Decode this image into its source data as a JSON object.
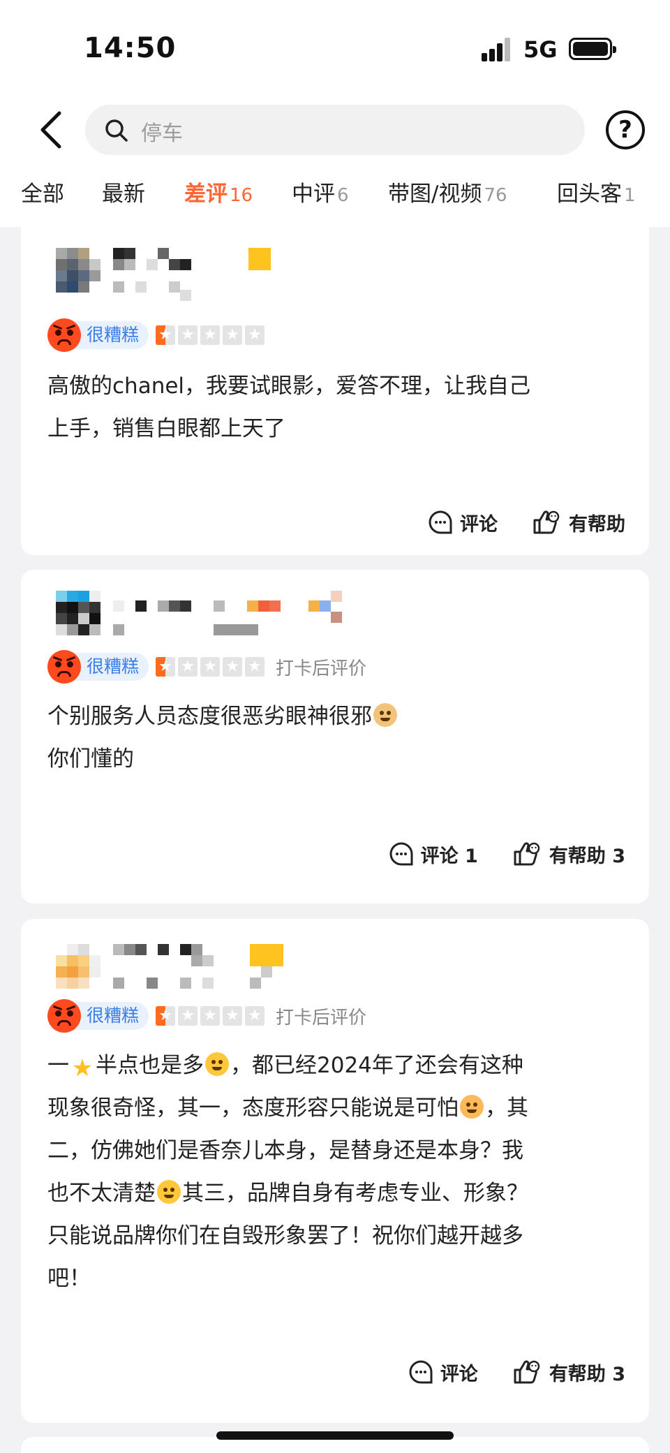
{
  "status_bar": {
    "time": "14:50",
    "network": "5G"
  },
  "search": {
    "placeholder": "停车"
  },
  "tabs": [
    {
      "label": "全部",
      "count": ""
    },
    {
      "label": "最新",
      "count": ""
    },
    {
      "label": "差评",
      "count": "16",
      "active": true
    },
    {
      "label": "中评",
      "count": "6"
    },
    {
      "label": "带图/视频",
      "count": "76"
    },
    {
      "label": "回头客",
      "count": "1"
    }
  ],
  "reviews": [
    {
      "rating_label": "很糟糕",
      "stars": 1,
      "tag": "",
      "text_lines": [
        "高傲的chanel，我要试眼影，爱答不理，让我自己",
        "上手，销售白眼都上天了"
      ],
      "comment_label": "评论",
      "helpful_label": "有帮助"
    },
    {
      "rating_label": "很糟糕",
      "stars": 1,
      "tag": "打卡后评价",
      "text_lines": [
        "个别服务人员态度很恶劣眼神很邪",
        "你们懂的"
      ],
      "comment_label": "评论 1",
      "helpful_label": "有帮助 3"
    },
    {
      "rating_label": "很糟糕",
      "stars": 1,
      "tag": "打卡后评价",
      "text_segments": {
        "l1a": "一",
        "l1b": "半点也是多",
        "l1c": "，都已经2024年了还会有这种",
        "l2a": "现象很奇怪，其一，态度形容只能说是可怕",
        "l2b": "，其",
        "l3": "二，仿佛她们是香奈儿本身，是替身还是本身？我",
        "l4a": "也不太清楚",
        "l4b": "其三，品牌自身有考虑专业、形象？",
        "l5": "只能说品牌你们在自毁形象罢了！祝你们越开越多",
        "l6": "吧！"
      },
      "comment_label": "评论",
      "helpful_label": "有帮助 3"
    }
  ],
  "colors": {
    "accent": "#ff6633",
    "badge_blue": "#3a7ee6",
    "angry": "#ff4a1f"
  },
  "icons": [
    "back-arrow-icon",
    "search-icon",
    "help-icon",
    "angry-face-icon",
    "star-icon",
    "comment-icon",
    "helpful-icon"
  ]
}
